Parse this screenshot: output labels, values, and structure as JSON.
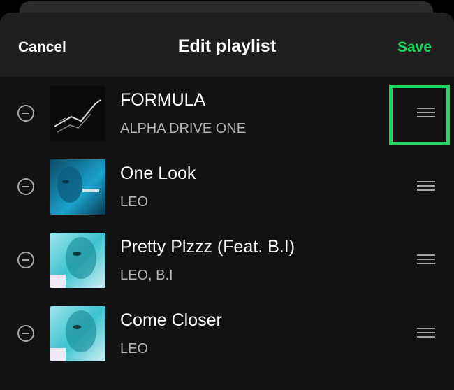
{
  "header": {
    "cancel_label": "Cancel",
    "title": "Edit playlist",
    "save_label": "Save"
  },
  "tracks": [
    {
      "title": "FORMULA",
      "artist": "ALPHA DRIVE ONE",
      "art": "formula-cover"
    },
    {
      "title": "One Look",
      "artist": "LEO",
      "art": "one-look-cover"
    },
    {
      "title": "Pretty Plzzz (Feat. B.I)",
      "artist": "LEO, B.I",
      "art": "leo-cover"
    },
    {
      "title": "Come Closer",
      "artist": "LEO",
      "art": "leo-cover"
    }
  ],
  "colors": {
    "accent": "#1ed760",
    "background": "#121212",
    "header": "#1f1f1f",
    "secondary_text": "#b3b3b3"
  },
  "icons": [
    "remove-icon",
    "drag-handle-icon"
  ],
  "highlighted_element": "drag-handle-icon (FORMULA row)"
}
